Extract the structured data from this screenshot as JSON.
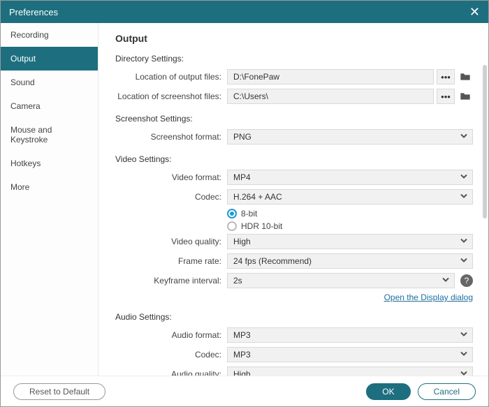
{
  "window": {
    "title": "Preferences"
  },
  "sidebar": {
    "items": [
      {
        "label": "Recording"
      },
      {
        "label": "Output",
        "active": true
      },
      {
        "label": "Sound"
      },
      {
        "label": "Camera"
      },
      {
        "label": "Mouse and Keystroke"
      },
      {
        "label": "Hotkeys"
      },
      {
        "label": "More"
      }
    ]
  },
  "page": {
    "title": "Output"
  },
  "directory": {
    "section": "Directory Settings:",
    "output_label": "Location of output files:",
    "output_value": "D:\\FonePaw",
    "screenshot_label": "Location of screenshot files:",
    "screenshot_value": "C:\\Users\\",
    "browse_label": "•••"
  },
  "screenshot": {
    "section": "Screenshot Settings:",
    "format_label": "Screenshot format:",
    "format_value": "PNG"
  },
  "video": {
    "section": "Video Settings:",
    "format_label": "Video format:",
    "format_value": "MP4",
    "codec_label": "Codec:",
    "codec_value": "H.264 + AAC",
    "bitdepth_8": "8-bit",
    "bitdepth_hdr": "HDR 10-bit",
    "quality_label": "Video quality:",
    "quality_value": "High",
    "framerate_label": "Frame rate:",
    "framerate_value": "24 fps (Recommend)",
    "keyframe_label": "Keyframe interval:",
    "keyframe_value": "2s",
    "display_link": "Open the Display dialog"
  },
  "audio": {
    "section": "Audio Settings:",
    "format_label": "Audio format:",
    "format_value": "MP3",
    "codec_label": "Codec:",
    "codec_value": "MP3",
    "quality_label": "Audio quality:",
    "quality_value": "High"
  },
  "footer": {
    "reset": "Reset to Default",
    "ok": "OK",
    "cancel": "Cancel"
  }
}
